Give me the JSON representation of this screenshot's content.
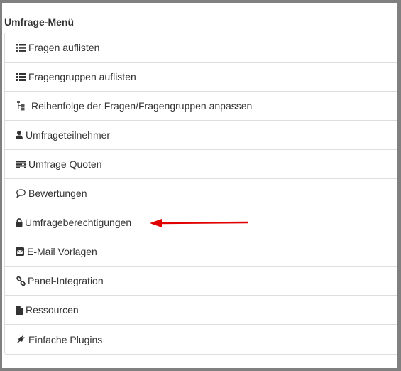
{
  "panel": {
    "title": "Umfrage-Menü"
  },
  "menu": {
    "items": [
      {
        "label": "Fragen auflisten",
        "icon": "list-icon"
      },
      {
        "label": "Fragengruppen auflisten",
        "icon": "list-icon"
      },
      {
        "label": "Reihenfolge der Fragen/Fragengruppen anpassen",
        "icon": "sitemap-icon"
      },
      {
        "label": "Umfrageteilnehmer",
        "icon": "user-icon"
      },
      {
        "label": "Umfrage Quoten",
        "icon": "tasks-icon"
      },
      {
        "label": "Bewertungen",
        "icon": "comment-icon"
      },
      {
        "label": "Umfrageberechtigungen",
        "icon": "lock-icon"
      },
      {
        "label": "E-Mail Vorlagen",
        "icon": "envelope-square-icon"
      },
      {
        "label": "Panel-Integration",
        "icon": "link-icon"
      },
      {
        "label": "Ressourcen",
        "icon": "file-icon"
      },
      {
        "label": "Einfache Plugins",
        "icon": "plug-icon"
      }
    ]
  },
  "annotation": {
    "arrow_color": "#e00000",
    "arrow_points_to": "Umfrageberechtigungen"
  }
}
